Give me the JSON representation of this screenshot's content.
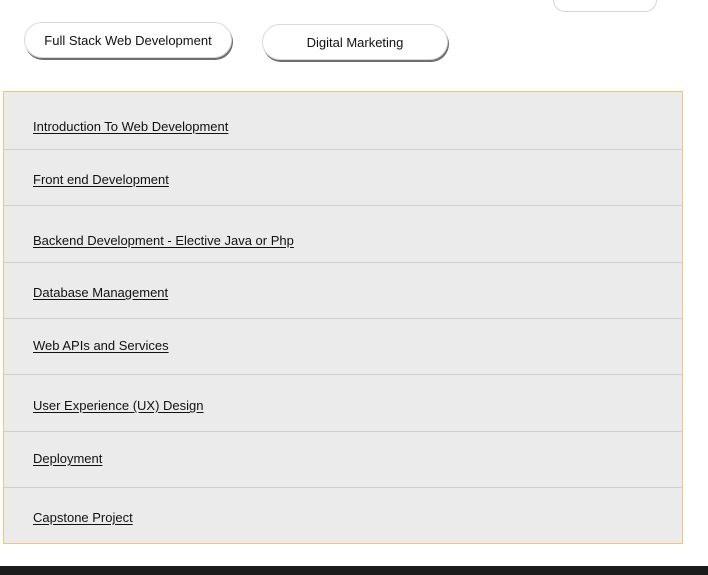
{
  "tabs": [
    {
      "label": "Full Stack Web Development"
    },
    {
      "label": "Digital Marketing"
    }
  ],
  "curriculum": {
    "items": [
      {
        "label": "Introduction To Web Development"
      },
      {
        "label": "Front end Development"
      },
      {
        "label": "Backend Development - Elective Java or Php"
      },
      {
        "label": "Database Management"
      },
      {
        "label": "Web APIs and Services"
      },
      {
        "label": "User Experience (UX) Design"
      },
      {
        "label": "Deployment"
      },
      {
        "label": "Capstone Project"
      }
    ]
  }
}
